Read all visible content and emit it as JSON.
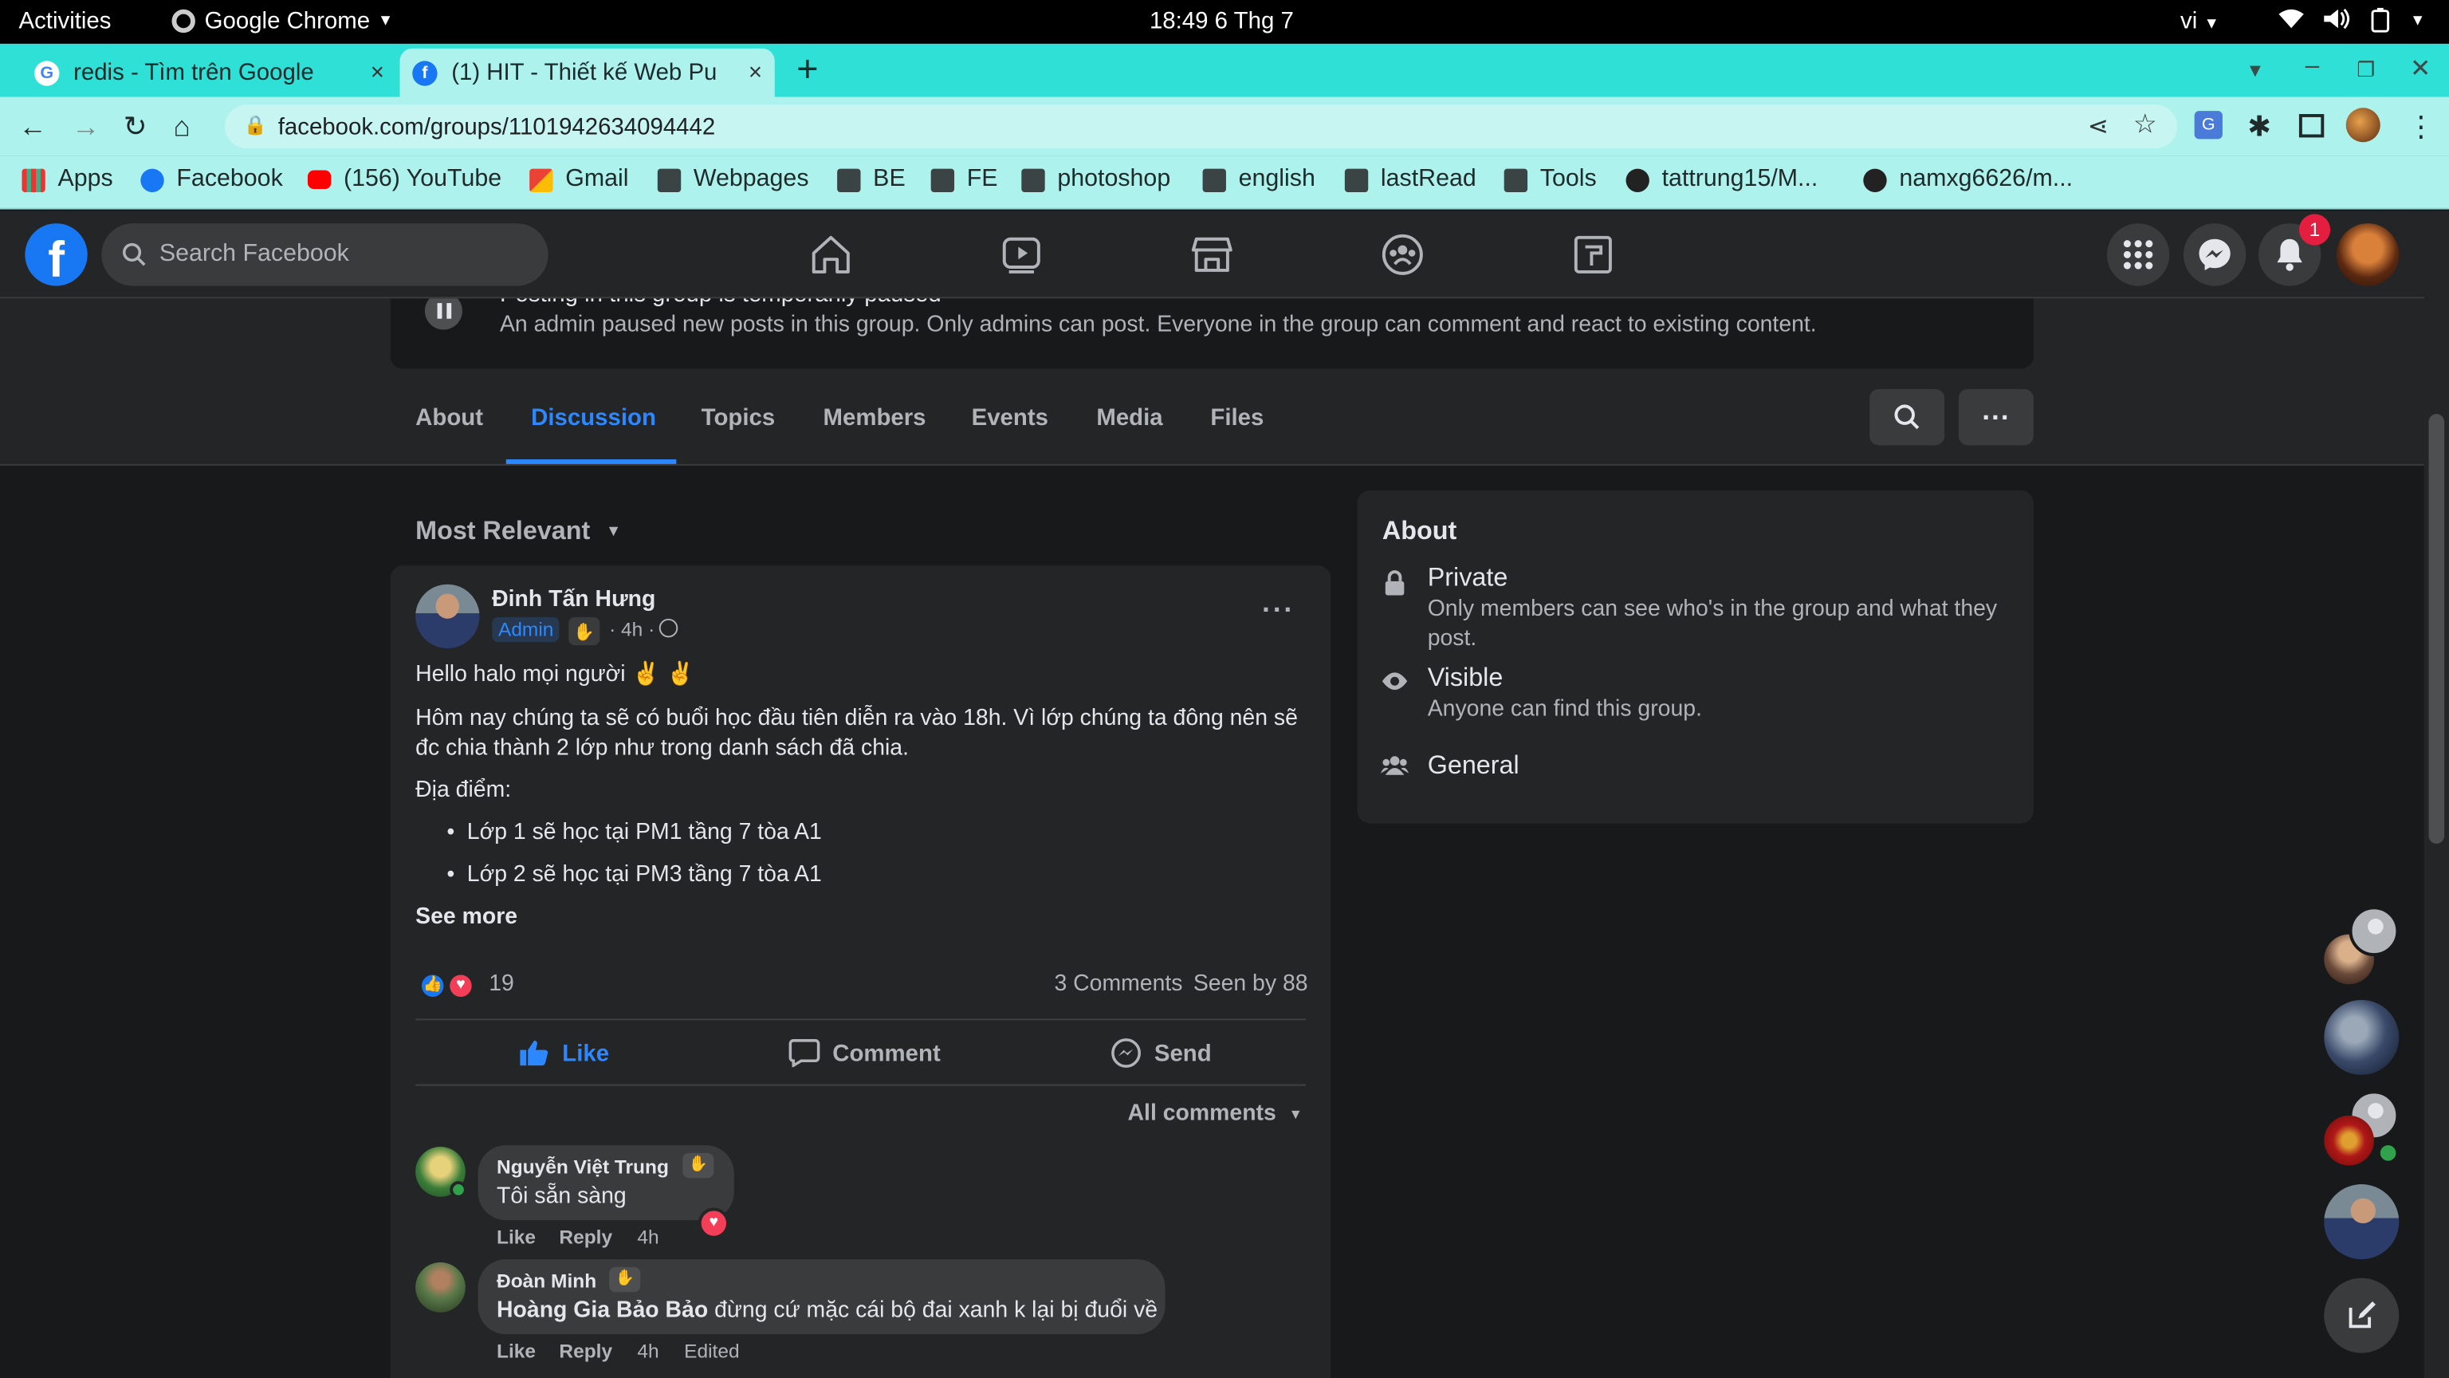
{
  "os_bar": {
    "activities": "Activities",
    "app": "Google Chrome",
    "clock": "18:49  6 Thg 7",
    "lang": "vi"
  },
  "tabs": [
    {
      "title": "redis - Tìm trên Google",
      "close": "×"
    },
    {
      "title": "(1) HIT - Thiết kế Web Pu",
      "close": "×"
    }
  ],
  "new_tab": "+",
  "url": "facebook.com/groups/1101942634094442",
  "bookmarks": [
    "Apps",
    "Facebook",
    "(156) YouTube",
    "Gmail",
    "Webpages",
    "BE",
    "FE",
    "photoshop",
    "english",
    "lastRead",
    "Tools",
    "tattrung15/M...",
    "namxg6626/m..."
  ],
  "fb": {
    "logo": "f",
    "search_placeholder": "Search Facebook",
    "notif_count": "1"
  },
  "paused": {
    "title": "Posting in this group is temporarily paused",
    "text": "An admin paused new posts in this group. Only admins can post. Everyone in the group can comment and react to existing content."
  },
  "group_tabs": [
    "About",
    "Discussion",
    "Topics",
    "Members",
    "Events",
    "Media",
    "Files"
  ],
  "sort_label": "Most Relevant",
  "post": {
    "author": "Đinh Tấn Hưng",
    "badge": "Admin",
    "time": "· 4h ·",
    "line1": "Hello halo mọi người ✌ ✌",
    "line2": "Hôm nay chúng ta sẽ có buổi học đầu tiên diễn ra vào 18h. Vì lớp chúng ta đông nên sẽ",
    "line3": "đc chia thành 2 lớp như trong danh sách đã chia.",
    "line4": "Địa điểm:",
    "bullet1": "Lớp 1 sẽ học tại PM1 tầng 7 tòa A1",
    "bullet2": "Lớp 2 sẽ học tại PM3 tầng 7 tòa A1",
    "see_more": "See more",
    "reactions": "19",
    "comments_count": "3 Comments",
    "seen": "Seen by 88",
    "actions": {
      "like": "Like",
      "comment": "Comment",
      "send": "Send"
    },
    "all_comments": "All comments"
  },
  "comments": [
    {
      "name": "Nguyễn Việt Trung",
      "text": "Tôi sẵn sàng",
      "like": "Like",
      "reply": "Reply",
      "time": "4h"
    },
    {
      "name": "Đoàn Minh",
      "mention": "Hoàng Gia Bảo Bảo",
      "text": " đừng cứ mặc cái bộ đai xanh k lại bị đuổi về",
      "like": "Like",
      "reply": "Reply",
      "time": "4h",
      "edited": "Edited"
    }
  ],
  "about": {
    "title": "About",
    "private_title": "Private",
    "private_text1": "Only members can see who's in the group and what they",
    "private_text2": "post.",
    "visible_title": "Visible",
    "visible_text": "Anyone can find this group.",
    "general": "General"
  },
  "colors": {
    "accent": "#2d88ff",
    "fb_blue": "#1877f2",
    "bg": "#18191a",
    "card": "#242526",
    "chrome_tab": "#2ee0d6"
  }
}
